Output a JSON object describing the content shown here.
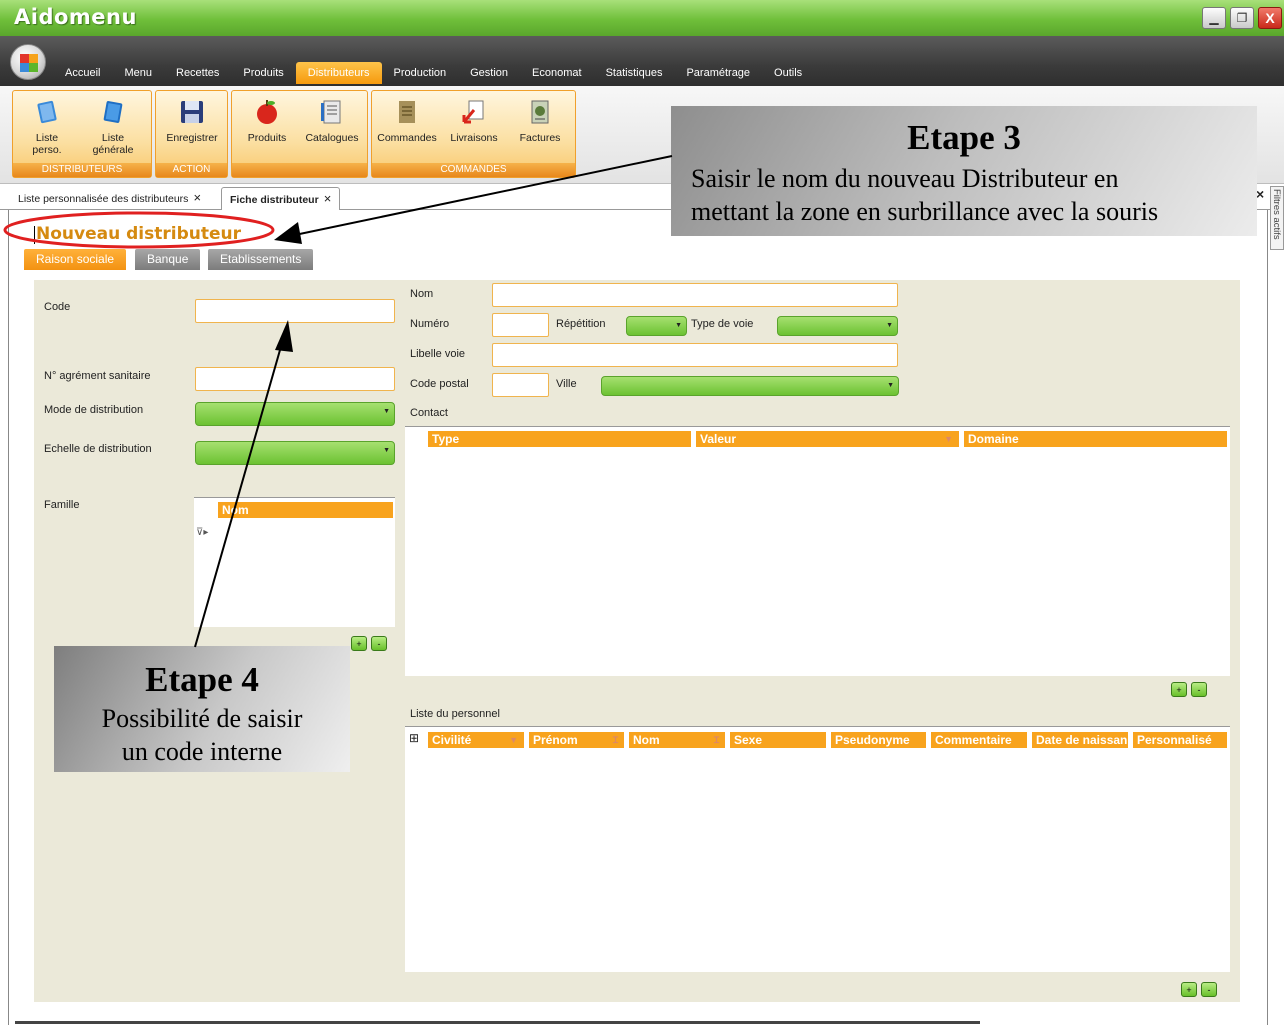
{
  "window": {
    "title": "Aidomenu",
    "minimize_icon": "minimize-icon",
    "maximize_icon": "restore-icon",
    "close_label": "X"
  },
  "menu": {
    "items": [
      "Accueil",
      "Menu",
      "Recettes",
      "Produits",
      "Distributeurs",
      "Production",
      "Gestion",
      "Economat",
      "Statistiques",
      "Paramétrage",
      "Outils"
    ],
    "active": "Distributeurs"
  },
  "ribbon": {
    "groups": [
      {
        "label": "DISTRIBUTEURS",
        "buttons": [
          {
            "line1": "Liste",
            "line2": "perso.",
            "icon": "list-perso-icon"
          },
          {
            "line1": "Liste",
            "line2": "générale",
            "icon": "list-general-icon"
          }
        ]
      },
      {
        "label": "ACTION",
        "buttons": [
          {
            "line1": "Enregistrer",
            "line2": "",
            "icon": "floppy-disk-icon"
          }
        ]
      },
      {
        "label": "",
        "buttons": [
          {
            "line1": "Produits",
            "line2": "",
            "icon": "apple-icon"
          },
          {
            "line1": "Catalogues",
            "line2": "",
            "icon": "catalog-icon"
          }
        ]
      },
      {
        "label": "COMMANDES",
        "buttons": [
          {
            "line1": "Commandes",
            "line2": "",
            "icon": "order-icon"
          },
          {
            "line1": "Livraisons",
            "line2": "",
            "icon": "delivery-icon"
          },
          {
            "line1": "Factures",
            "line2": "",
            "icon": "invoice-icon"
          }
        ]
      }
    ]
  },
  "doc_tabs": [
    {
      "label": "Liste personnalisée des distributeurs",
      "close": "×"
    },
    {
      "label": "Fiche distributeur",
      "close": "×"
    }
  ],
  "side_panel": {
    "label": "Filtres actifs",
    "close": "×"
  },
  "form": {
    "title": "Nouveau distributeur",
    "tabs": [
      "Raison sociale",
      "Banque",
      "Etablissements"
    ],
    "left": {
      "code_label": "Code",
      "agrement_label": "N° agrément sanitaire",
      "mode_label": "Mode de distribution",
      "echelle_label": "Echelle de distribution",
      "famille_label": "Famille",
      "famille_column": "Nom"
    },
    "address": {
      "nom_label": "Nom",
      "numero_label": "Numéro",
      "repetition_label": "Répétition",
      "type_voie_label": "Type de voie",
      "libelle_label": "Libelle voie",
      "code_postal_label": "Code postal",
      "ville_label": "Ville"
    },
    "contact": {
      "label": "Contact",
      "columns": [
        "Type",
        "Valeur",
        "Domaine"
      ]
    },
    "personnel": {
      "label": "Liste du personnel",
      "columns": [
        "Civilité",
        "Prénom",
        "Nom",
        "Sexe",
        "Pseudonyme",
        "Commentaire",
        "Date de naissan",
        "Personnalisé"
      ]
    },
    "add_label": "+",
    "remove_label": "-"
  },
  "callouts": {
    "step3": {
      "title": "Etape 3",
      "line1": "Saisir le nom du nouveau Distributeur en",
      "line2": "mettant la zone en surbrillance avec la souris"
    },
    "step4": {
      "title": "Etape 4",
      "line1": "Possibilité de saisir",
      "line2": "un code interne"
    }
  },
  "colors": {
    "accent": "#f8a31d",
    "green": "#6cc232",
    "title_orange": "#d58a10",
    "highlight_red": "#e02020"
  }
}
